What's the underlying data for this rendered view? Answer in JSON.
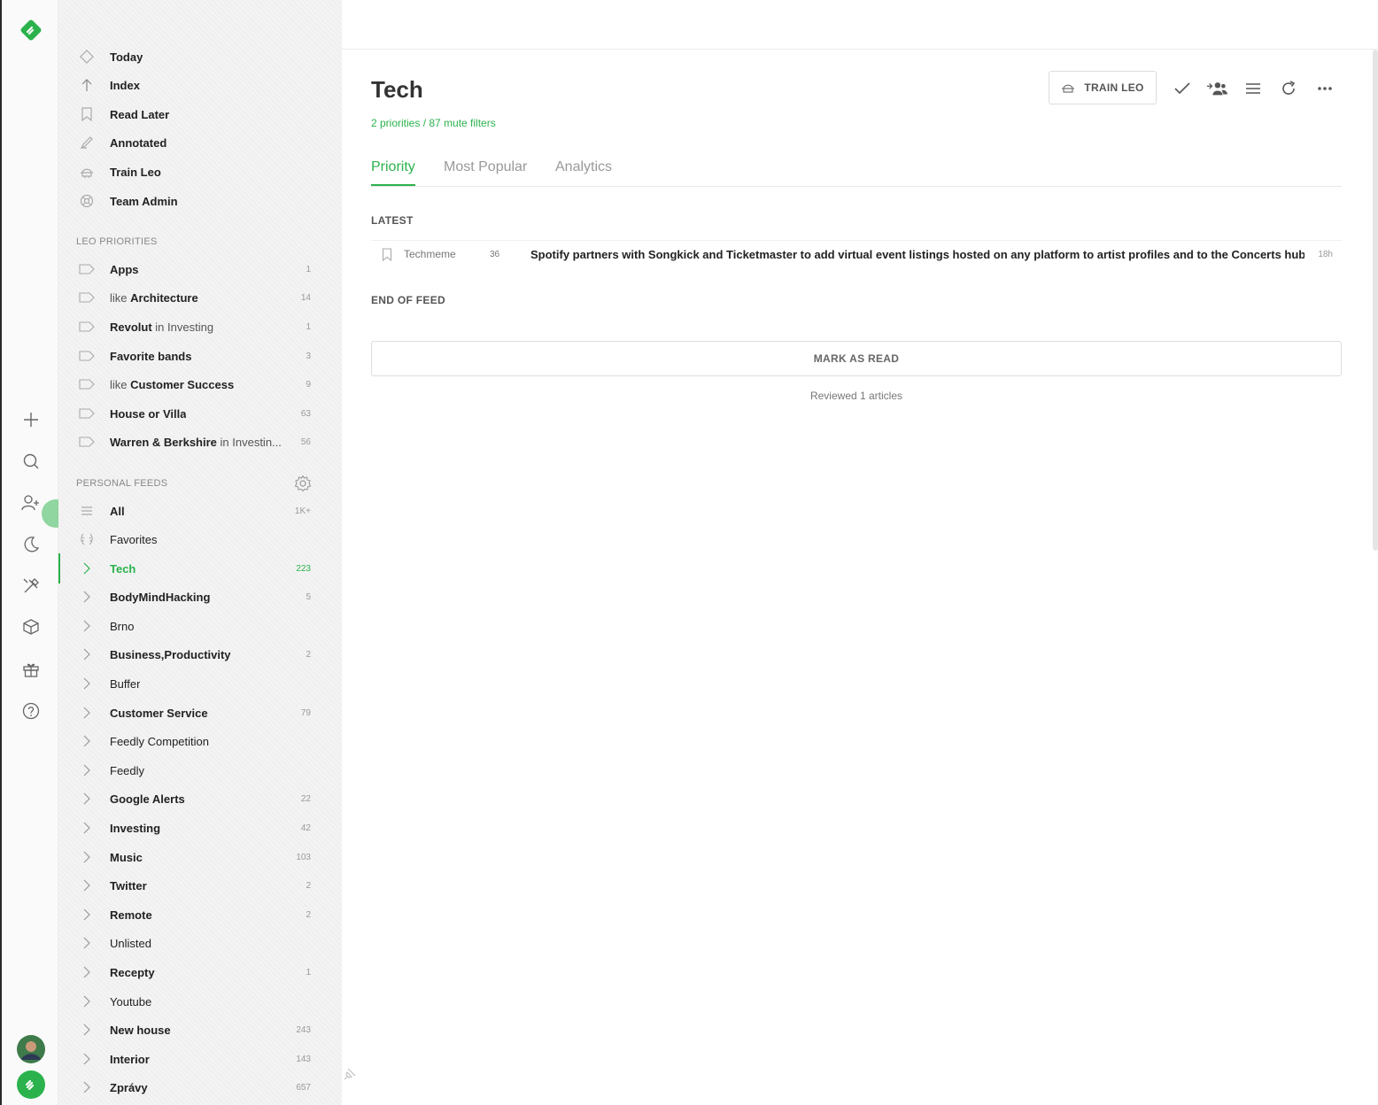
{
  "rail": {
    "logo_icon": "feedly-logo-icon",
    "items": [
      "add-icon",
      "search-icon",
      "add-user-icon",
      "moon-icon",
      "tools-icon",
      "cube-icon",
      "gift-icon",
      "help-icon"
    ],
    "avatar_icon": "avatar",
    "brand_color": "#2bb24c"
  },
  "nav": {
    "items": [
      {
        "label": "Today",
        "icon": "diamond-icon"
      },
      {
        "label": "Index",
        "icon": "arrow-up-icon"
      },
      {
        "label": "Read Later",
        "icon": "bookmark-icon"
      },
      {
        "label": "Annotated",
        "icon": "pen-icon"
      },
      {
        "label": "Train Leo",
        "icon": "leo-icon"
      },
      {
        "label": "Team Admin",
        "icon": "lifebuoy-icon"
      }
    ]
  },
  "leo": {
    "title": "LEO PRIORITIES",
    "items": [
      {
        "pre": "",
        "main": "Apps",
        "post": "",
        "count": "1"
      },
      {
        "pre": "like ",
        "main": "Architecture",
        "post": "",
        "count": "14"
      },
      {
        "pre": "",
        "main": "Revolut",
        "post": " in Investing",
        "count": "1"
      },
      {
        "pre": "",
        "main": "Favorite bands",
        "post": "",
        "count": "3"
      },
      {
        "pre": "like ",
        "main": "Customer Success",
        "post": "",
        "count": "9"
      },
      {
        "pre": "",
        "main": "House or Villa",
        "post": "",
        "count": "63"
      },
      {
        "pre": "",
        "main": "Warren & Berkshire",
        "post": " in Investin...",
        "count": "56"
      }
    ]
  },
  "feeds": {
    "title": "PERSONAL FEEDS",
    "all": {
      "label": "All",
      "count": "1K+"
    },
    "favorites": {
      "label": "Favorites"
    },
    "items": [
      {
        "label": "Tech",
        "count": "223",
        "bold": true
      },
      {
        "label": "BodyMindHacking",
        "count": "5",
        "bold": true
      },
      {
        "label": "Brno",
        "count": "",
        "bold": false
      },
      {
        "label": "Business,Productivity",
        "count": "2",
        "bold": true
      },
      {
        "label": "Buffer",
        "count": "",
        "bold": false
      },
      {
        "label": "Customer Service",
        "count": "79",
        "bold": true
      },
      {
        "label": "Feedly Competition",
        "count": "",
        "bold": false
      },
      {
        "label": "Feedly",
        "count": "",
        "bold": false
      },
      {
        "label": "Google Alerts",
        "count": "22",
        "bold": true
      },
      {
        "label": "Investing",
        "count": "42",
        "bold": true
      },
      {
        "label": "Music",
        "count": "103",
        "bold": true
      },
      {
        "label": "Twitter",
        "count": "2",
        "bold": true
      },
      {
        "label": "Remote",
        "count": "2",
        "bold": true
      },
      {
        "label": "Unlisted",
        "count": "",
        "bold": false
      },
      {
        "label": "Recepty",
        "count": "1",
        "bold": true
      },
      {
        "label": "Youtube",
        "count": "",
        "bold": false
      },
      {
        "label": "New house",
        "count": "243",
        "bold": true
      },
      {
        "label": "Interior",
        "count": "143",
        "bold": true
      },
      {
        "label": "Zprávy",
        "count": "657",
        "bold": true
      }
    ]
  },
  "main": {
    "title": "Tech",
    "subline": "2 priorities / 87 mute filters",
    "train_button": "TRAIN LEO",
    "tabs": [
      "Priority",
      "Most Popular",
      "Analytics"
    ],
    "latest_label": "LATEST",
    "article": {
      "source": "Techmeme",
      "count": "36",
      "title": "Spotify partners with Songkick and Ticketmaster to add virtual event listings hosted on any platform to artist profiles and to the Concerts hub",
      "age": "18h"
    },
    "end_label": "END OF FEED",
    "mark_button": "MARK AS READ",
    "reviewed": "Reviewed 1 articles"
  }
}
